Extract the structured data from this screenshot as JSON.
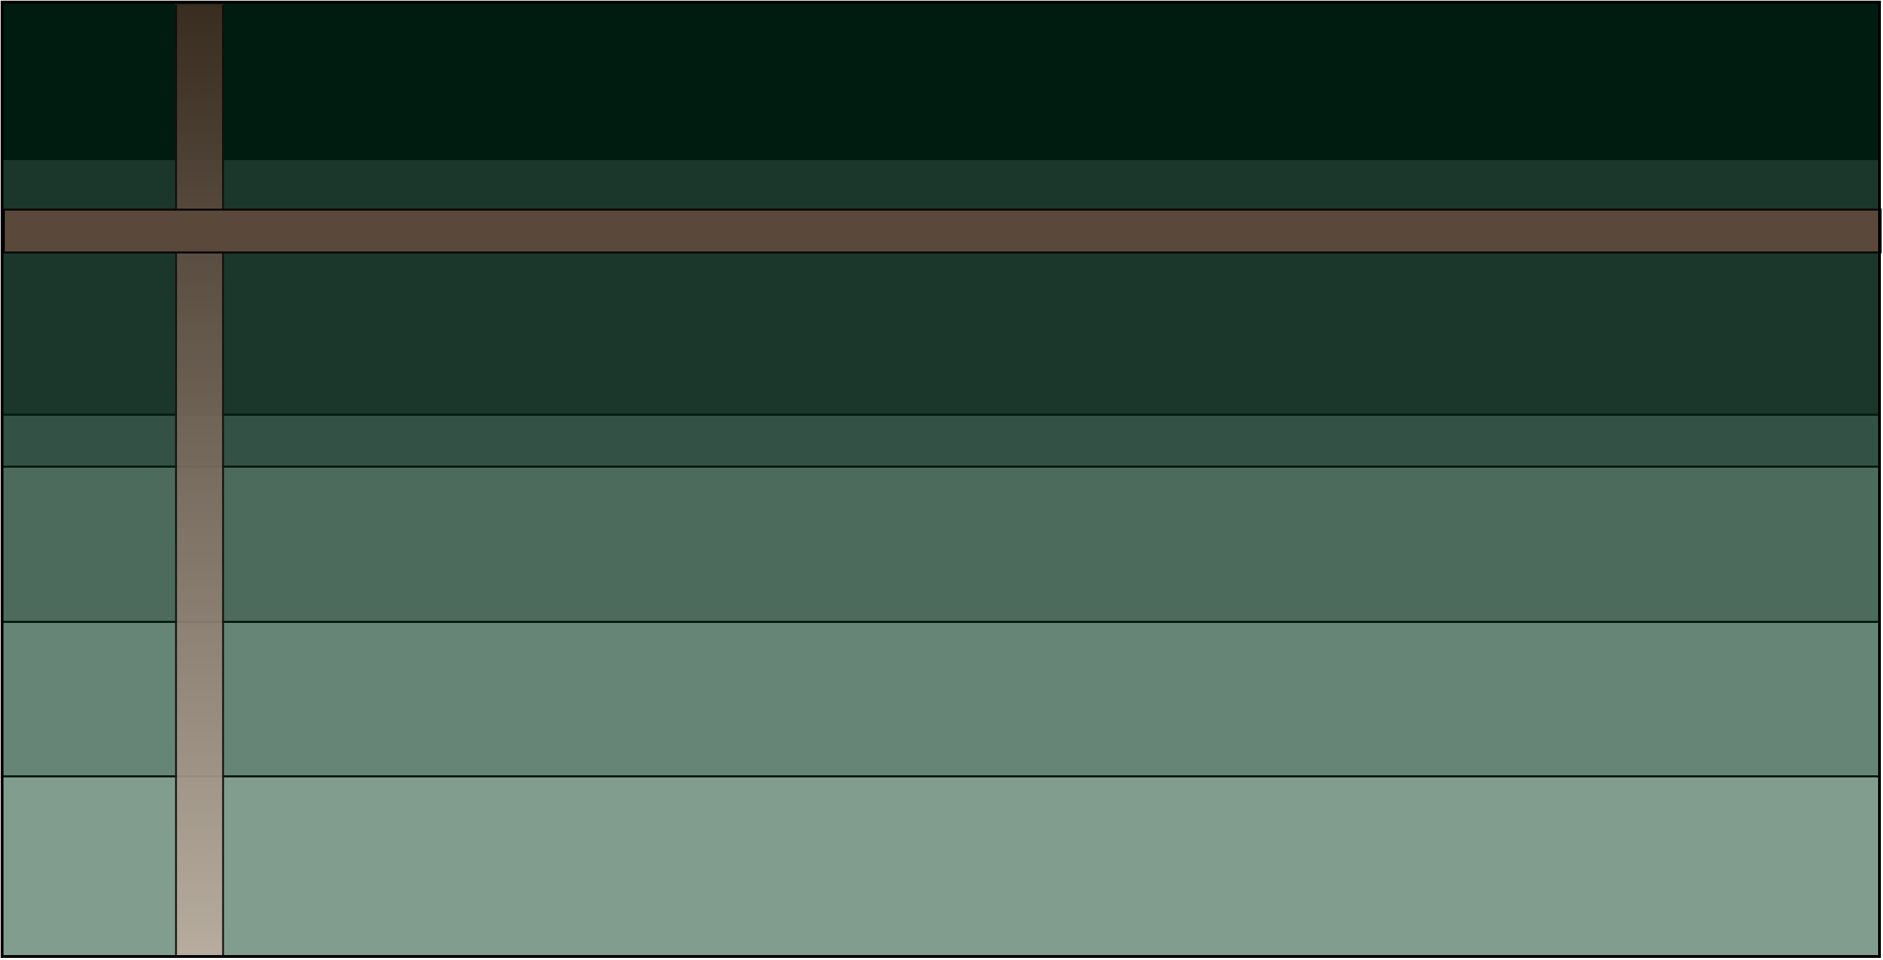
{
  "colors": {
    "bands": [
      "#001c10",
      "#1b372b",
      "#335144",
      "#4c6b5c",
      "#668576",
      "#809d8d"
    ],
    "crossbar": "#5a483a",
    "upright_top": "#3f2f22",
    "upright_bottom": "#bcaea0",
    "outline": "#001a0f"
  }
}
